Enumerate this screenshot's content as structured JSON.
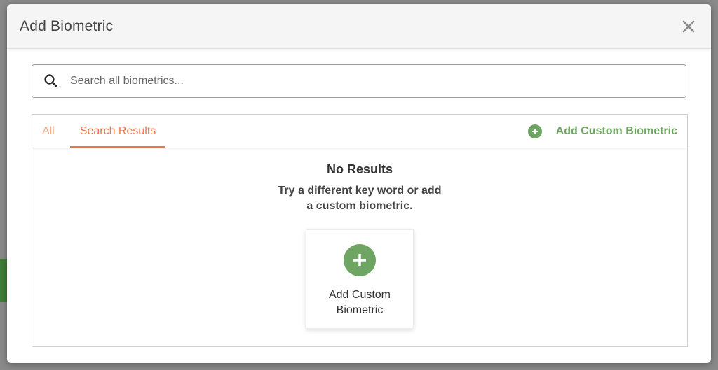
{
  "modal": {
    "title": "Add Biometric",
    "close_icon": "close-icon"
  },
  "search": {
    "placeholder": "Search all biometrics...",
    "value": "",
    "icon": "search-icon"
  },
  "tabs": [
    {
      "label": "All",
      "active": false
    },
    {
      "label": "Search Results",
      "active": true
    }
  ],
  "add_custom_link": {
    "label": "Add Custom Biometric",
    "icon": "plus-circle-icon"
  },
  "empty_state": {
    "title": "No Results",
    "message": "Try a different key word or add a custom biometric."
  },
  "custom_card": {
    "label": "Add Custom Biometric",
    "icon": "plus-circle-icon"
  },
  "colors": {
    "accent_orange": "#e8784c",
    "accent_green": "#6fa562"
  }
}
